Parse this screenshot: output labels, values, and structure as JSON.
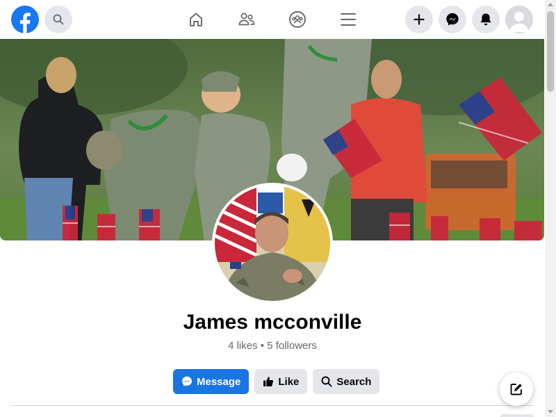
{
  "header": {
    "logo_icon": "facebook-logo-icon",
    "brand_color": "#1877f2",
    "search_icon": "search-icon",
    "nav": [
      {
        "name": "home",
        "icon": "home-icon"
      },
      {
        "name": "friends",
        "icon": "friends-icon"
      },
      {
        "name": "groups",
        "icon": "groups-icon"
      },
      {
        "name": "menu",
        "icon": "hamburger-menu-icon"
      }
    ],
    "right": [
      {
        "name": "create",
        "icon": "plus-icon"
      },
      {
        "name": "messenger",
        "icon": "messenger-icon"
      },
      {
        "name": "notifications",
        "icon": "bell-icon"
      },
      {
        "name": "account",
        "icon": "account-avatar-icon"
      }
    ]
  },
  "profile": {
    "name": "James mcconville",
    "stats": "4 likes • 5 followers"
  },
  "actions": {
    "message_label": "Message",
    "like_label": "Like",
    "search_label": "Search",
    "primary_color": "#1b74e4"
  },
  "floating": {
    "compose_icon": "compose-edit-icon"
  }
}
